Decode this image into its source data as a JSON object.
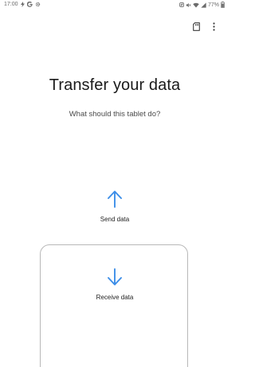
{
  "status_bar": {
    "time": "17:00",
    "battery": "77%",
    "left_icons": [
      "charging-bolt-icon",
      "google-icon",
      "settings-gear-icon"
    ],
    "right_icons": [
      "nfc-icon",
      "mute-icon",
      "wifi-icon",
      "signal-icon",
      "battery-icon"
    ]
  },
  "toolbar": {
    "icons": [
      "sd-card-icon",
      "more-vert-icon"
    ]
  },
  "page": {
    "title": "Transfer your data",
    "subtitle": "What should this tablet do?"
  },
  "options": {
    "send_label": "Send data",
    "receive_label": "Receive data"
  },
  "colors": {
    "accent": "#3d8ee8",
    "card_border": "#b8b8b8",
    "text_primary": "#1a1a1a",
    "text_secondary": "#4a4a4a"
  }
}
